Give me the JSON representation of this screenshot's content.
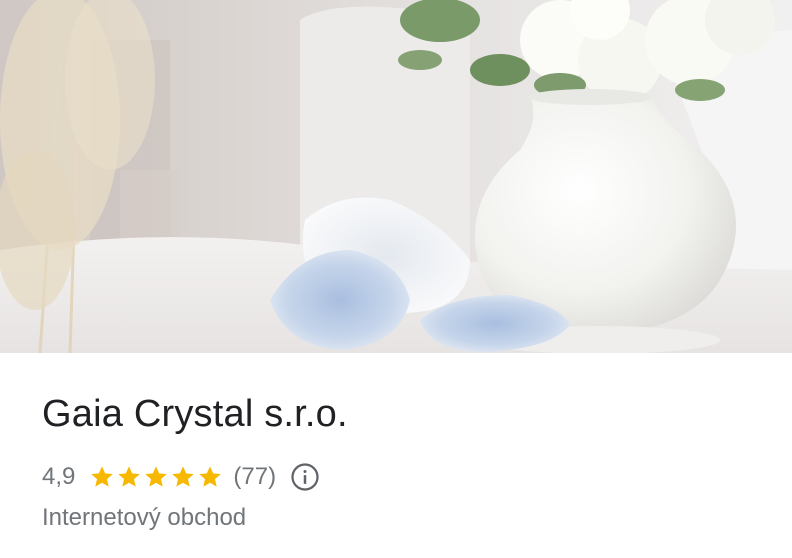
{
  "place": {
    "name": "Gaia Crystal s.r.o.",
    "rating": "4,9",
    "stars": 5,
    "review_count": "(77)",
    "category": "Internetový obchod"
  },
  "icons": {
    "star": "star-icon",
    "info": "info-icon"
  },
  "colors": {
    "star": "#f6b800",
    "title": "#202124",
    "secondary_text": "#70757a"
  }
}
